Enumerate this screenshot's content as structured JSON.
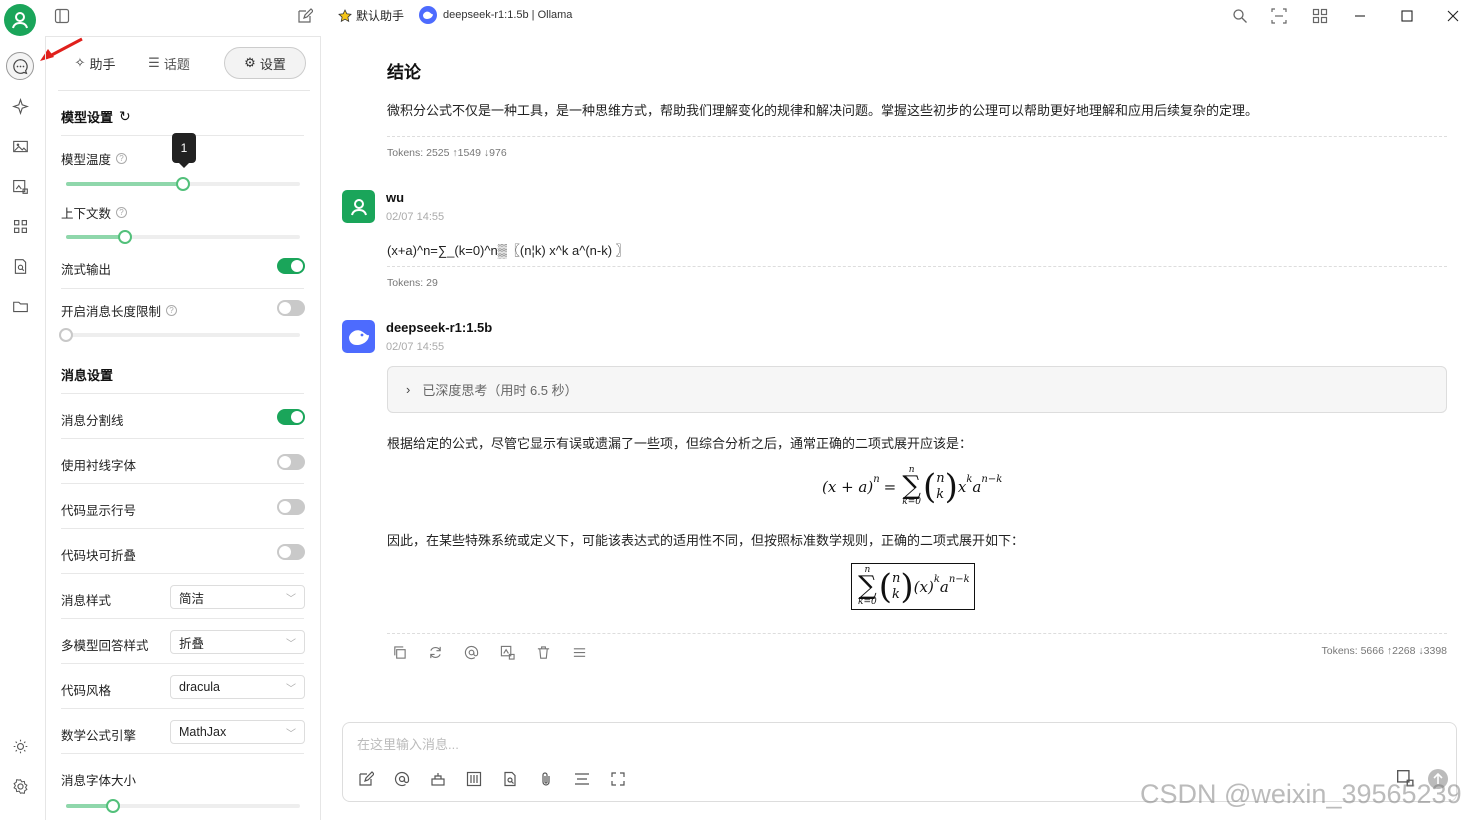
{
  "topbar": {
    "assistant_name": "默认助手",
    "model_label": "deepseek-r1:1.5b | Ollama"
  },
  "sidebar_tabs": {
    "assistant": "助手",
    "topics": "话题",
    "settings": "设置"
  },
  "model_settings": {
    "title": "模型设置",
    "temperature_label": "模型温度",
    "temperature_value": "1",
    "temperature_fraction": 0.5,
    "context_label": "上下文数",
    "context_fraction": 0.25,
    "stream_label": "流式输出",
    "stream_on": true,
    "max_length_label": "开启消息长度限制",
    "max_length_on": false
  },
  "message_settings": {
    "title": "消息设置",
    "divider_label": "消息分割线",
    "divider_on": true,
    "serif_label": "使用衬线字体",
    "serif_on": false,
    "line_numbers_label": "代码显示行号",
    "line_numbers_on": false,
    "collapsible_label": "代码块可折叠",
    "collapsible_on": false,
    "style_label": "消息样式",
    "style_value": "简洁",
    "multi_model_label": "多模型回答样式",
    "multi_model_value": "折叠",
    "code_style_label": "代码风格",
    "code_style_value": "dracula",
    "math_engine_label": "数学公式引擎",
    "math_engine_value": "MathJax",
    "font_size_label": "消息字体大小",
    "font_size_fraction": 0.2
  },
  "chat": {
    "prev_heading": "结论",
    "prev_text": "微积分公式不仅是一种工具，是一种思维方式，帮助我们理解变化的规律和解决问题。掌握这些初步的公理可以帮助更好地理解和应用后续复杂的定理。",
    "prev_tokens": "Tokens: 2525 ↑1549 ↓976",
    "user": {
      "name": "wu",
      "time": "02/07 14:55",
      "text": "(x+a)^n=∑_(k=0)^n▒〖(n¦k) x^k a^(n-k) 〗",
      "tokens": "Tokens: 29"
    },
    "bot": {
      "name": "deepseek-r1:1.5b",
      "time": "02/07 14:55",
      "thinking": "已深度思考（用时 6.5 秒）",
      "text1": "根据给定的公式，尽管它显示有误或遗漏了一些项，但综合分析之后，通常正确的二项式展开应该是：",
      "text2": "因此，在某些特殊系统或定义下，可能该表达式的适用性不同，但按照标准数学规则，正确的二项式展开如下：",
      "tokens": "Tokens: 5666 ↑2268 ↓3398"
    }
  },
  "input": {
    "placeholder": "在这里输入消息..."
  },
  "watermark": "CSDN @weixin_39565239"
}
